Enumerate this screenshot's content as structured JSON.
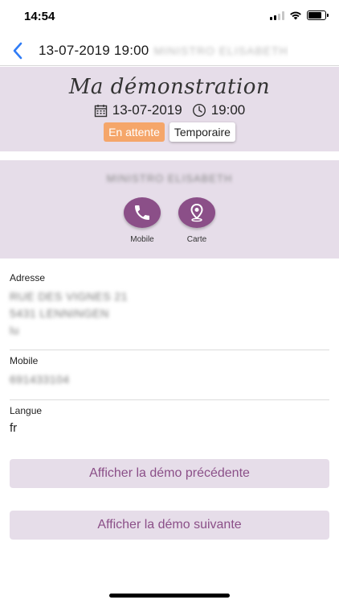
{
  "status_bar": {
    "time": "14:54"
  },
  "nav": {
    "title": "13-07-2019 19:00",
    "title_name": "MINISTRO ELISABETH"
  },
  "header": {
    "title": "Ma démonstration",
    "date": "13-07-2019",
    "time": "19:00",
    "badges": {
      "status": "En attente",
      "type": "Temporaire"
    }
  },
  "contact": {
    "name": "MINISTRO ELISABETH",
    "actions": {
      "mobile_label": "Mobile",
      "map_label": "Carte"
    }
  },
  "fields": {
    "address": {
      "label": "Adresse",
      "line1": "RUE DES VIGNES 21",
      "line2": "5431 LENNINGEN",
      "line3": "lu"
    },
    "mobile": {
      "label": "Mobile",
      "value": "691433104"
    },
    "language": {
      "label": "Langue",
      "value": "fr"
    }
  },
  "buttons": {
    "previous": "Afficher la démo précédente",
    "next": "Afficher la démo suivante"
  },
  "colors": {
    "accent": "#8b4f88",
    "card_bg": "#e6dde9",
    "pending_badge": "#f5a66a",
    "ios_blue": "#2f7cf6"
  },
  "icons": {
    "back": "chevron-left-icon",
    "calendar": "calendar-icon",
    "clock": "clock-icon",
    "phone": "phone-icon",
    "map": "map-pin-icon"
  }
}
